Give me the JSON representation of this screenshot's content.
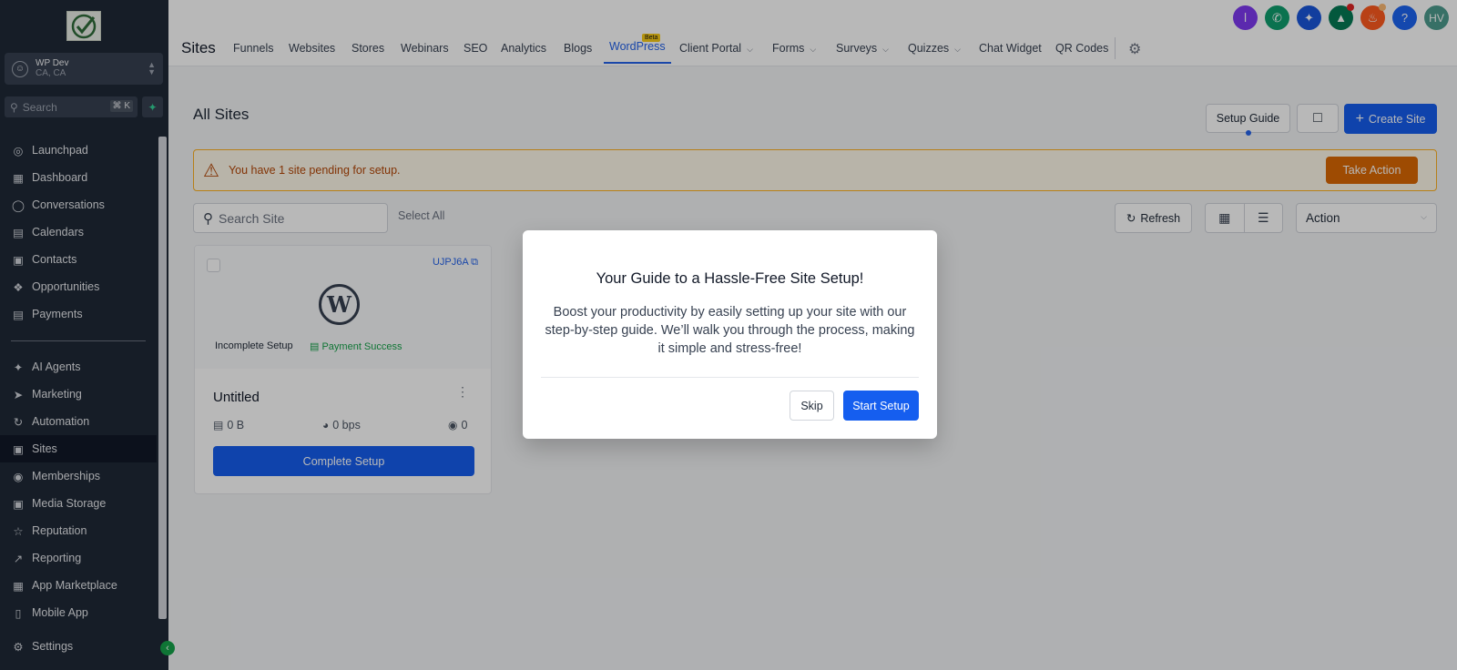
{
  "sidebar": {
    "account": {
      "name": "WP Dev",
      "location": "CA, CA"
    },
    "search": {
      "placeholder": "Search",
      "shortcut": "⌘ K"
    },
    "items": [
      {
        "label": "Launchpad",
        "icon": "rocket-icon"
      },
      {
        "label": "Dashboard",
        "icon": "dashboard-icon"
      },
      {
        "label": "Conversations",
        "icon": "chat-icon"
      },
      {
        "label": "Calendars",
        "icon": "calendar-icon"
      },
      {
        "label": "Contacts",
        "icon": "contacts-icon"
      },
      {
        "label": "Opportunities",
        "icon": "opportunities-icon"
      },
      {
        "label": "Payments",
        "icon": "payments-icon"
      },
      {
        "label": "AI Agents",
        "icon": "sparkle-icon"
      },
      {
        "label": "Marketing",
        "icon": "send-icon"
      },
      {
        "label": "Automation",
        "icon": "automation-icon"
      },
      {
        "label": "Sites",
        "icon": "sites-icon"
      },
      {
        "label": "Memberships",
        "icon": "memberships-icon"
      },
      {
        "label": "Media Storage",
        "icon": "image-icon"
      },
      {
        "label": "Reputation",
        "icon": "star-icon"
      },
      {
        "label": "Reporting",
        "icon": "trend-icon"
      },
      {
        "label": "App Marketplace",
        "icon": "grid-icon"
      },
      {
        "label": "Mobile App",
        "icon": "mobile-icon"
      }
    ],
    "settings_label": "Settings"
  },
  "header": {
    "title": "Sites",
    "beta_badge": "Beta",
    "tabs": [
      {
        "label": "Funnels"
      },
      {
        "label": "Websites"
      },
      {
        "label": "Stores"
      },
      {
        "label": "Webinars"
      },
      {
        "label": "SEO"
      },
      {
        "label": "Analytics"
      },
      {
        "label": "Blogs"
      },
      {
        "label": "WordPress"
      },
      {
        "label": "Client Portal"
      },
      {
        "label": "Forms"
      },
      {
        "label": "Surveys"
      },
      {
        "label": "Quizzes"
      },
      {
        "label": "Chat Widget"
      },
      {
        "label": "QR Codes"
      }
    ],
    "avatar_initials": "HV"
  },
  "main": {
    "title": "All Sites",
    "setup_guide_label": "Setup Guide",
    "create_site_label": "Create Site",
    "alert": {
      "message": "You have 1 site pending for setup.",
      "action_label": "Take Action"
    },
    "search_placeholder": "Search Site",
    "select_all_label": "Select All",
    "refresh_label": "Refresh",
    "action_select_value": "Action"
  },
  "site_card": {
    "id": "UJPJ6A",
    "status": "Incomplete Setup",
    "payment_status": "Payment Success",
    "name": "Untitled",
    "storage": "0 B",
    "bandwidth": "0 bps",
    "views": "0",
    "button_label": "Complete Setup"
  },
  "modal": {
    "title": "Your Guide to a Hassle-Free Site Setup!",
    "body": "Boost your productivity by easily setting up your site with our step-by-step guide. We’ll walk you through the process, making it simple and stress-free!",
    "skip_label": "Skip",
    "start_label": "Start Setup"
  },
  "colors": {
    "primary": "#155eef",
    "sidebar_bg": "#1f2937",
    "alert_bg": "#fffaeb",
    "alert_text": "#b54708",
    "success": "#16a34a"
  }
}
